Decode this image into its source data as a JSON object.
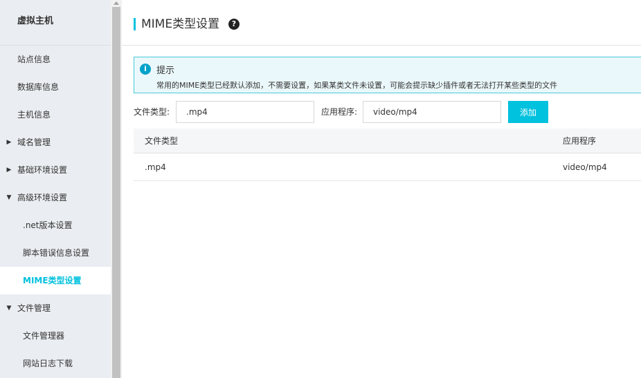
{
  "sidebar": {
    "title": "虚拟主机",
    "items": [
      {
        "label": "站点信息"
      },
      {
        "label": "数据库信息"
      },
      {
        "label": "主机信息"
      },
      {
        "label": "域名管理"
      },
      {
        "label": "基础环境设置"
      },
      {
        "label": "高级环境设置"
      },
      {
        "label": ".net版本设置"
      },
      {
        "label": "脚本错误信息设置"
      },
      {
        "label": "MIME类型设置"
      },
      {
        "label": "文件管理"
      },
      {
        "label": "文件管理器"
      },
      {
        "label": "网站日志下载"
      }
    ],
    "active_color": "#00c1de"
  },
  "header": {
    "title": "MIME类型设置",
    "help_icon": "question-circle-icon"
  },
  "notice": {
    "icon": "info-circle-icon",
    "title": "提示",
    "text": "常用的MIME类型已经默认添加，不需要设置，如果某类文件未设置，可能会提示缺少插件或者无法打开某些类型的文件"
  },
  "form": {
    "file_type_label": "文件类型:",
    "file_type_value": ".mp4",
    "app_label": "应用程序:",
    "app_value": "video/mp4",
    "add_label": "添加"
  },
  "table": {
    "columns": [
      "文件类型",
      "应用程序"
    ],
    "rows": [
      [
        ".mp4",
        "video/mp4"
      ]
    ]
  },
  "colors": {
    "accent": "#00c1de",
    "notice_border": "#45c8d9",
    "notice_bg": "#ebf8fb"
  }
}
